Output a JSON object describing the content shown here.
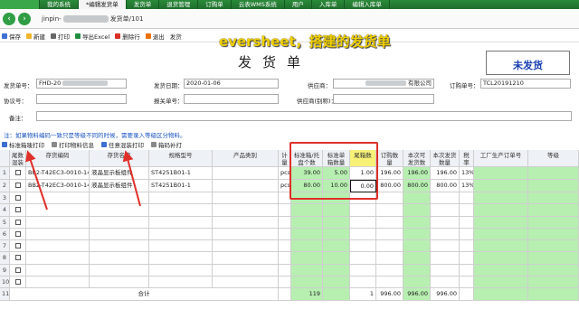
{
  "tabs": [
    "",
    "我的系统",
    "*编辑发货单",
    "发货单",
    "退货管理",
    "订购单",
    "云表WMS系统",
    "用户",
    "入库单",
    "编辑入库单"
  ],
  "address": {
    "prefix": "jinpin-",
    "suffix": "发货单/101"
  },
  "toolbar": [
    "保存",
    "新建",
    "打印",
    "导出Excel",
    "删除行",
    "退出",
    "发货"
  ],
  "overlay_title": "eversheet，搭建的发货单",
  "doc_title": "发货单",
  "status": "未发货",
  "form": {
    "shipno_label": "发货单号：",
    "shipno_value": "FHD-20",
    "date_label": "发货日期：",
    "date_value": "2020-01-06",
    "supplier_label": "供应商：",
    "supplier_value": "有限公司",
    "order_label": "订购单号：",
    "order_value": "TCL20191210",
    "agreement_label": "协议号：",
    "agreement_value": "",
    "customs_label": "报关单号：",
    "customs_value": "",
    "supplier_alias_label": "供应商(别称)：",
    "supplier_alias_value": "",
    "remark_label": "备注：",
    "remark_value": ""
  },
  "note": "注：如果物料编码一致只是等级不同的时候，需要录入等级区分物料。",
  "subbar": [
    "标准箱唛打印",
    "打印物料信息",
    "任意混装打印",
    "箱码补打"
  ],
  "headers": [
    "",
    "尾数混装",
    "存货编码",
    "存货名称",
    "规格型号",
    "产品类别",
    "计量单位",
    "标准箱/托盘个数",
    "标准单箱数量",
    "尾箱数",
    "订购数量",
    "本次可发货数量",
    "本次发货数量",
    "税率",
    "工厂生产订单号",
    "等级"
  ],
  "rows": [
    {
      "n": "1",
      "code": "BB2-T42EC3-0010-14",
      "name": "液晶显示板组件",
      "spec": "ST4251B01-1",
      "unit": "pcs",
      "per_pallet": "39.00",
      "per_box": "5.00",
      "tail": "1.00",
      "order_qty": "196.00",
      "avail_qty": "196.00",
      "ship_qty": "196.00",
      "tax": "13%"
    },
    {
      "n": "2",
      "code": "BB2-T42EC3-0010-14",
      "name": "液晶显示板组件",
      "spec": "ST4251B01-1",
      "unit": "pcs",
      "per_pallet": "80.00",
      "per_box": "10.00",
      "tail": "0.00",
      "order_qty": "800.00",
      "avail_qty": "800.00",
      "ship_qty": "800.00",
      "tax": "13%"
    }
  ],
  "empty_rows": [
    "3",
    "4",
    "5",
    "6",
    "7",
    "8",
    "9",
    "10"
  ],
  "total": {
    "n": "11",
    "label": "合计",
    "per_pallet": "119",
    "tail": "1",
    "order_qty": "996.00",
    "avail_qty": "996.00",
    "ship_qty": "996.00"
  }
}
